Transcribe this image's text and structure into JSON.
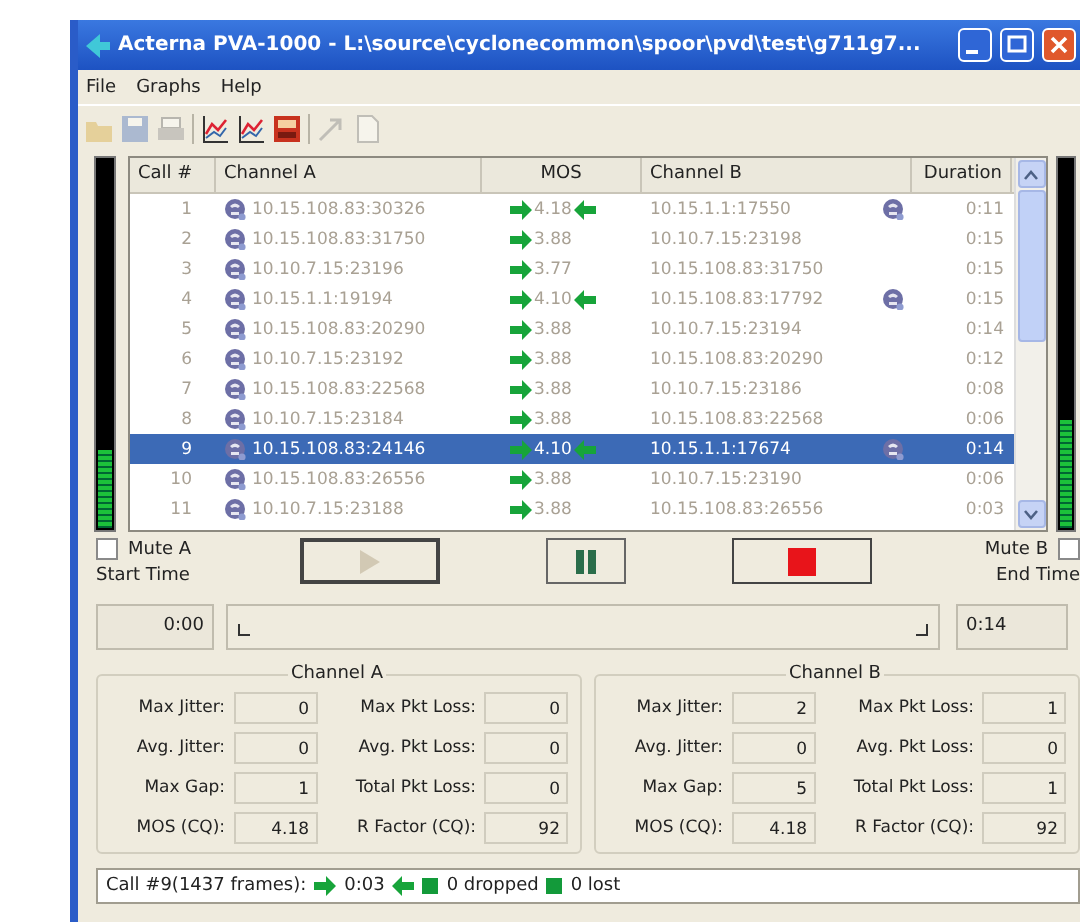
{
  "window": {
    "title": "Acterna PVA-1000 - L:\\source\\cyclonecommon\\spoor\\pvd\\test\\g711g7..."
  },
  "menu": [
    {
      "label": "File"
    },
    {
      "label": "Graphs"
    },
    {
      "label": "Help"
    }
  ],
  "toolbar": [
    {
      "kind": "open",
      "disabled": true
    },
    {
      "kind": "save",
      "disabled": true
    },
    {
      "kind": "print",
      "disabled": true
    },
    {
      "kind": "graph",
      "disabled": false
    },
    {
      "kind": "graph",
      "disabled": false
    },
    {
      "kind": "report",
      "disabled": false
    },
    {
      "kind": "pointer",
      "disabled": true
    },
    {
      "kind": "page",
      "disabled": true
    }
  ],
  "meters": {
    "left": {
      "level": 0.22
    },
    "right": {
      "level": 0.3
    }
  },
  "table": {
    "columns": [
      "Call #",
      "Channel A",
      "MOS",
      "Channel B",
      "Duration"
    ],
    "rows": [
      {
        "call": "1",
        "channel_a": "10.15.108.83:30326",
        "mos": "4.18",
        "return_arrow": true,
        "channel_b": "10.15.1.1:17550",
        "b_phone": true,
        "duration": "0:11",
        "selected": false
      },
      {
        "call": "2",
        "channel_a": "10.15.108.83:31750",
        "mos": "3.88",
        "return_arrow": false,
        "channel_b": "10.10.7.15:23198",
        "b_phone": false,
        "duration": "0:15",
        "selected": false
      },
      {
        "call": "3",
        "channel_a": "10.10.7.15:23196",
        "mos": "3.77",
        "return_arrow": false,
        "channel_b": "10.15.108.83:31750",
        "b_phone": false,
        "duration": "0:15",
        "selected": false
      },
      {
        "call": "4",
        "channel_a": "10.15.1.1:19194",
        "mos": "4.10",
        "return_arrow": true,
        "channel_b": "10.15.108.83:17792",
        "b_phone": true,
        "duration": "0:15",
        "selected": false
      },
      {
        "call": "5",
        "channel_a": "10.15.108.83:20290",
        "mos": "3.88",
        "return_arrow": false,
        "channel_b": "10.10.7.15:23194",
        "b_phone": false,
        "duration": "0:14",
        "selected": false
      },
      {
        "call": "6",
        "channel_a": "10.10.7.15:23192",
        "mos": "3.88",
        "return_arrow": false,
        "channel_b": "10.15.108.83:20290",
        "b_phone": false,
        "duration": "0:12",
        "selected": false
      },
      {
        "call": "7",
        "channel_a": "10.15.108.83:22568",
        "mos": "3.88",
        "return_arrow": false,
        "channel_b": "10.10.7.15:23186",
        "b_phone": false,
        "duration": "0:08",
        "selected": false
      },
      {
        "call": "8",
        "channel_a": "10.10.7.15:23184",
        "mos": "3.88",
        "return_arrow": false,
        "channel_b": "10.15.108.83:22568",
        "b_phone": false,
        "duration": "0:06",
        "selected": false
      },
      {
        "call": "9",
        "channel_a": "10.15.108.83:24146",
        "mos": "4.10",
        "return_arrow": true,
        "channel_b": "10.15.1.1:17674",
        "b_phone": true,
        "duration": "0:14",
        "selected": true
      },
      {
        "call": "10",
        "channel_a": "10.15.108.83:26556",
        "mos": "3.88",
        "return_arrow": false,
        "channel_b": "10.10.7.15:23190",
        "b_phone": false,
        "duration": "0:06",
        "selected": false
      },
      {
        "call": "11",
        "channel_a": "10.10.7.15:23188",
        "mos": "3.88",
        "return_arrow": false,
        "channel_b": "10.15.108.83:26556",
        "b_phone": false,
        "duration": "0:03",
        "selected": false
      }
    ]
  },
  "mute_a": {
    "label": "Mute A",
    "checked": false
  },
  "mute_b": {
    "label": "Mute B",
    "checked": false
  },
  "buttons": [
    {
      "kind": "play",
      "disabled": true
    },
    {
      "kind": "pause",
      "disabled": false
    },
    {
      "kind": "stop",
      "disabled": false
    }
  ],
  "start_time": {
    "label": "Start Time",
    "value": "0:00"
  },
  "end_time": {
    "label": "End Time",
    "value": "0:14"
  },
  "time_slider": {
    "level": 0
  },
  "channels": [
    {
      "title": "Channel A",
      "stats": [
        {
          "label": "Max Jitter:",
          "value": "0"
        },
        {
          "label": "Max Pkt Loss:",
          "value": "0"
        },
        {
          "label": "Avg. Jitter:",
          "value": "0"
        },
        {
          "label": "Avg. Pkt Loss:",
          "value": "0"
        },
        {
          "label": "Max Gap:",
          "value": "1"
        },
        {
          "label": "Total Pkt Loss:",
          "value": "0"
        },
        {
          "label": "MOS (CQ):",
          "value": "4.18"
        },
        {
          "label": "R Factor (CQ):",
          "value": "92"
        }
      ]
    },
    {
      "title": "Channel B",
      "stats": [
        {
          "label": "Max Jitter:",
          "value": "2"
        },
        {
          "label": "Max Pkt Loss:",
          "value": "1"
        },
        {
          "label": "Avg. Jitter:",
          "value": "0"
        },
        {
          "label": "Avg. Pkt Loss:",
          "value": "0"
        },
        {
          "label": "Max Gap:",
          "value": "5"
        },
        {
          "label": "Total Pkt Loss:",
          "value": "1"
        },
        {
          "label": "MOS (CQ):",
          "value": "4.18"
        },
        {
          "label": "R Factor (CQ):",
          "value": "92"
        }
      ]
    }
  ],
  "status_bar": {
    "call": "Call #9(1437 frames):",
    "time": "0:03",
    "dropped": "0 dropped",
    "lost": "0 lost"
  }
}
